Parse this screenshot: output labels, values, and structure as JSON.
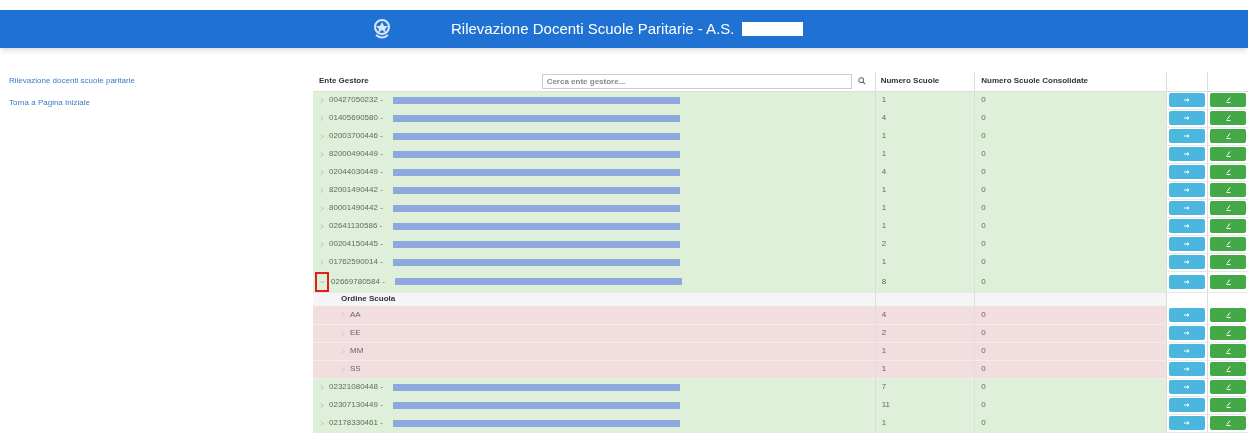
{
  "header": {
    "title": "Rilevazione Docenti Scuole Paritarie - A.S."
  },
  "sidebar": {
    "items": [
      {
        "label": "Rilevazione docenti scuole paritarie"
      },
      {
        "label": "Torna a Pagina Iniziale"
      }
    ]
  },
  "table": {
    "columns": [
      "Ente Gestore",
      "Numero Scuole",
      "Numero Scuole Consolidate"
    ],
    "search": {
      "placeholder": "Cerca ente gestore..."
    },
    "rows": [
      {
        "code": "00427050232 -",
        "schools": "1",
        "consolidated": "0",
        "expanded": false,
        "highlighted": false
      },
      {
        "code": "01405690580 -",
        "schools": "4",
        "consolidated": "0",
        "expanded": false,
        "highlighted": false
      },
      {
        "code": "02003700446 -",
        "schools": "1",
        "consolidated": "0",
        "expanded": false,
        "highlighted": false
      },
      {
        "code": "82000490449 -",
        "schools": "1",
        "consolidated": "0",
        "expanded": false,
        "highlighted": false
      },
      {
        "code": "02044030449 -",
        "schools": "4",
        "consolidated": "0",
        "expanded": false,
        "highlighted": false
      },
      {
        "code": "82001490442 -",
        "schools": "1",
        "consolidated": "0",
        "expanded": false,
        "highlighted": false
      },
      {
        "code": "80001490442 -",
        "schools": "1",
        "consolidated": "0",
        "expanded": false,
        "highlighted": false
      },
      {
        "code": "02641130586 -",
        "schools": "1",
        "consolidated": "0",
        "expanded": false,
        "highlighted": false
      },
      {
        "code": "00204150445 -",
        "schools": "2",
        "consolidated": "0",
        "expanded": false,
        "highlighted": false
      },
      {
        "code": "01762590014 -",
        "schools": "1",
        "consolidated": "0",
        "expanded": false,
        "highlighted": false
      },
      {
        "code": "02669780584 -",
        "schools": "8",
        "consolidated": "0",
        "expanded": true,
        "highlighted": true,
        "children_header": "Ordine Scuola",
        "children": [
          {
            "code": "AA",
            "schools": "4",
            "consolidated": "0"
          },
          {
            "code": "EE",
            "schools": "2",
            "consolidated": "0"
          },
          {
            "code": "MM",
            "schools": "1",
            "consolidated": "0"
          },
          {
            "code": "SS",
            "schools": "1",
            "consolidated": "0"
          }
        ]
      },
      {
        "code": "02321080448 -",
        "schools": "7",
        "consolidated": "0",
        "expanded": false,
        "highlighted": false
      },
      {
        "code": "02307130449 -",
        "schools": "11",
        "consolidated": "0",
        "expanded": false,
        "highlighted": false
      },
      {
        "code": "02178330461 -",
        "schools": "1",
        "consolidated": "0",
        "expanded": false,
        "highlighted": false
      }
    ]
  }
}
